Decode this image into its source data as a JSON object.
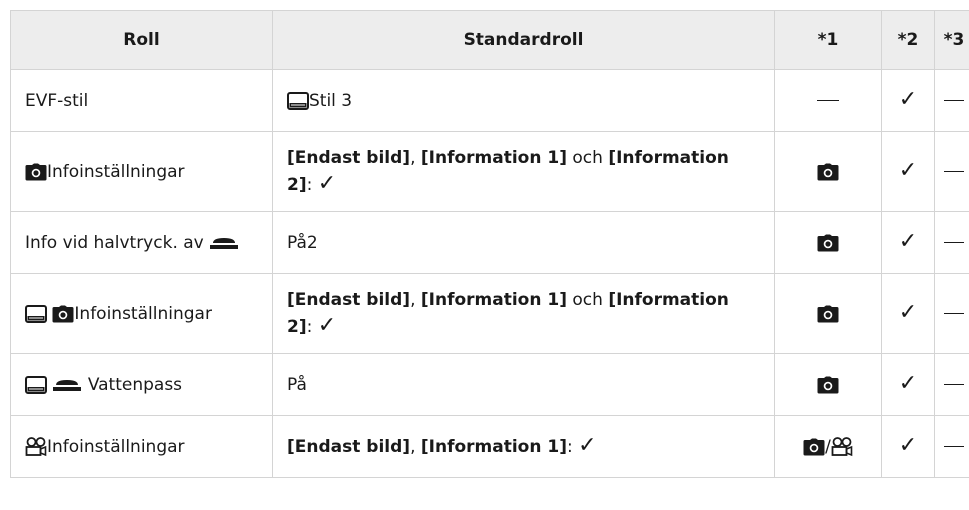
{
  "table": {
    "headers": [
      "Roll",
      "Standardroll",
      "*1",
      "*2",
      "*3"
    ],
    "rows": [
      {
        "roll_label": "EVF-stil",
        "standard_text": "Stil 3",
        "col1": "—",
        "col2": "✓",
        "col3": "—"
      },
      {
        "roll_label": "Infoinställningar",
        "standard": {
          "part1": "[Endast bild]",
          "sep1": ", ",
          "part2": "[Information 1]",
          "mid": " och ",
          "part3": "[Information 2]",
          "end": ": ",
          "check": "✓"
        },
        "col2": "✓",
        "col3": "—"
      },
      {
        "roll_label": "Info vid halvtryck. av",
        "standard_text": "På2",
        "col2": "✓",
        "col3": "—"
      },
      {
        "roll_label": "Infoinställningar",
        "standard": {
          "part1": "[Endast bild]",
          "sep1": ", ",
          "part2": "[Information 1]",
          "mid": " och ",
          "part3": "[Information 2]",
          "end": ": ",
          "check": "✓"
        },
        "col2": "✓",
        "col3": "—"
      },
      {
        "roll_label": "Vattenpass",
        "standard_text": "På",
        "col2": "✓",
        "col3": "—"
      },
      {
        "roll_label": "Infoinställningar",
        "standard": {
          "part1": "[Endast bild]",
          "sep1": ", ",
          "part2": "[Information 1]",
          "end": ": ",
          "check": "✓"
        },
        "col1_sep": "/",
        "col2": "✓",
        "col3": "—"
      }
    ],
    "icons": [
      "evf-monitor-icon",
      "camera-icon",
      "shutter-button-icon",
      "movie-camera-icon",
      "checkmark-icon"
    ]
  }
}
